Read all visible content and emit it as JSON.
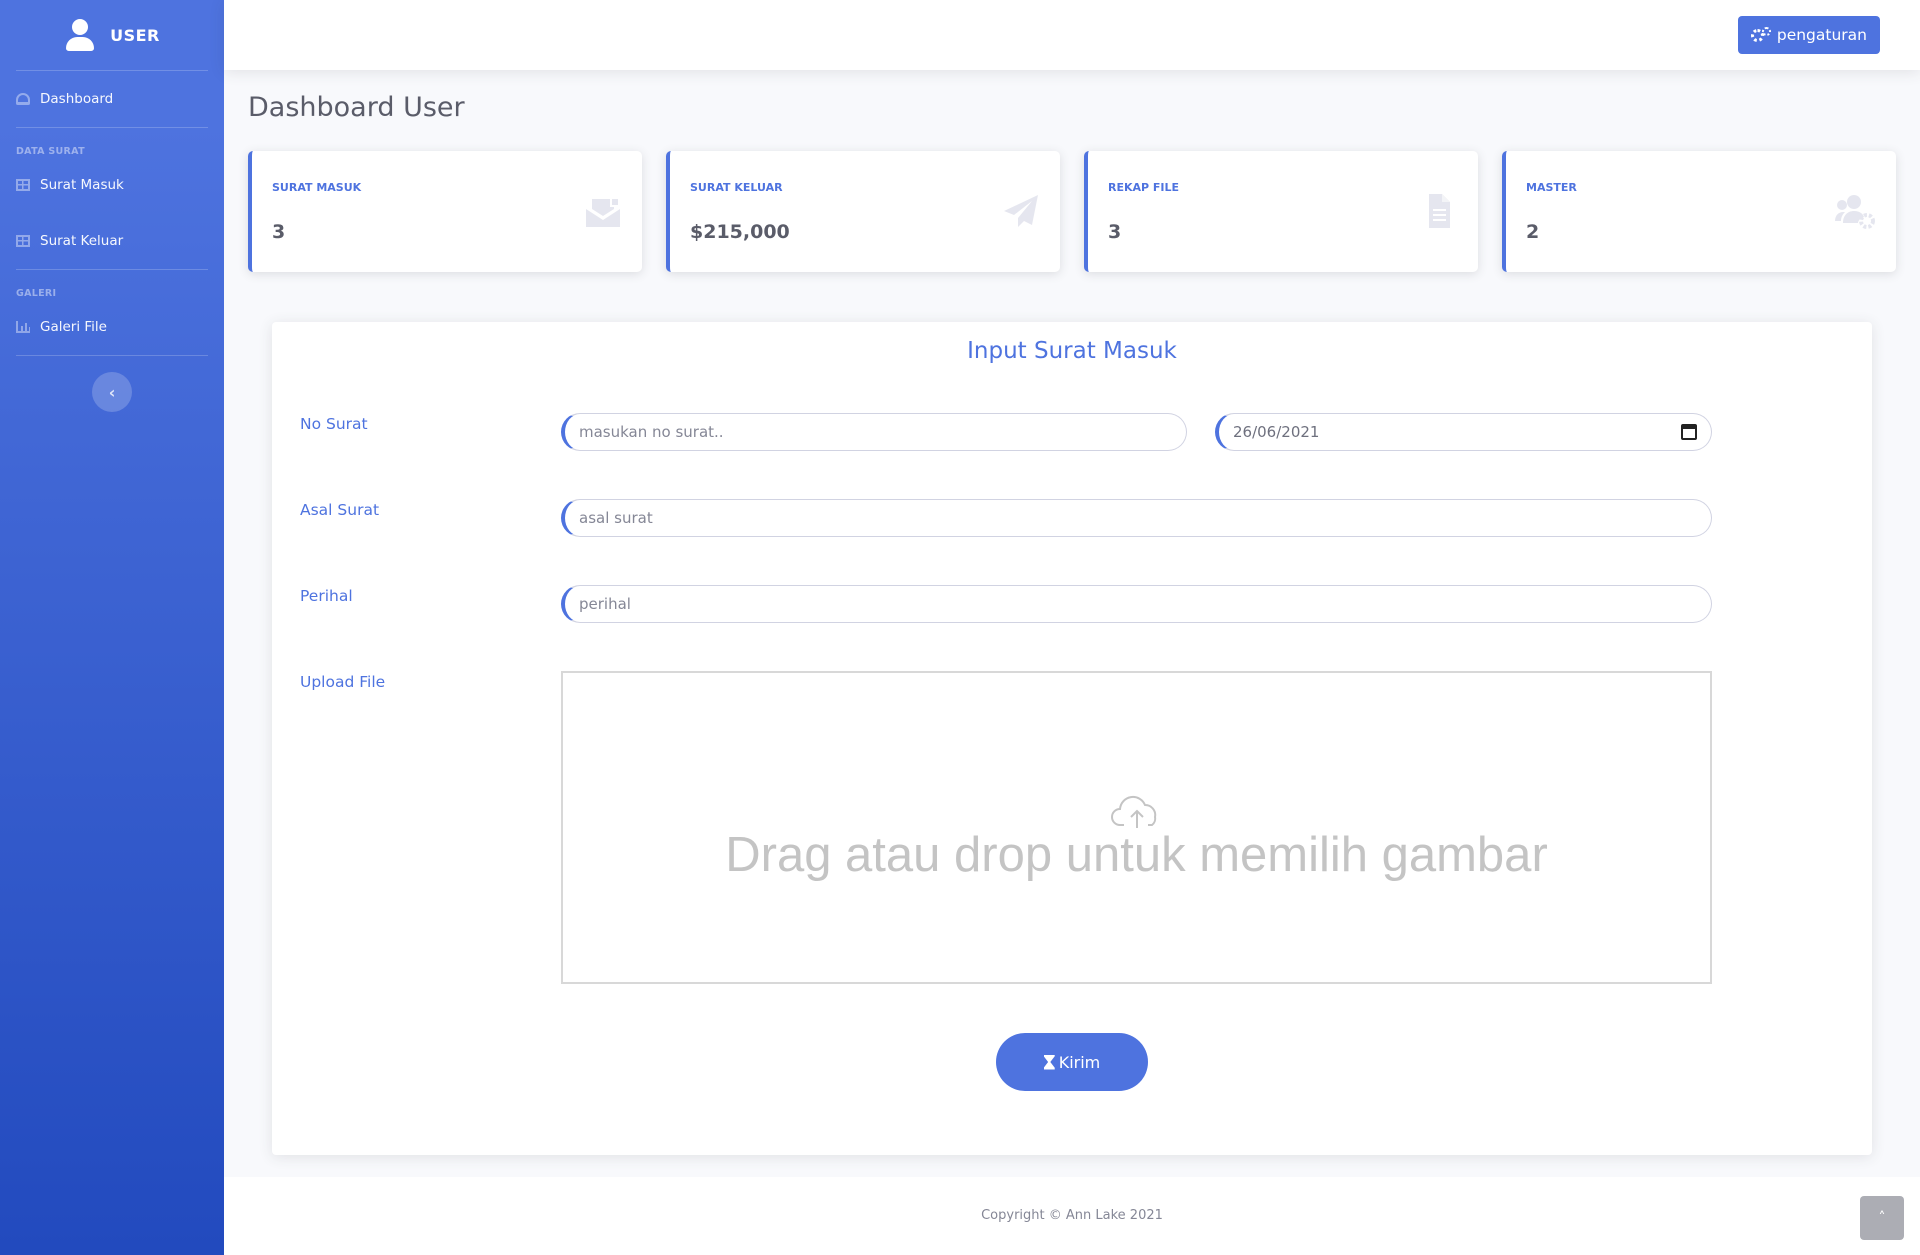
{
  "colors": {
    "primary": "#4e73df",
    "sidebar_gradient_start": "#4e73df",
    "sidebar_gradient_end": "#224abe"
  },
  "sidebar": {
    "brand": "USER",
    "brand_icon": "user-icon",
    "items": [
      {
        "label": "Dashboard",
        "icon": "tachometer-icon"
      },
      {
        "label": "Surat Masuk",
        "icon": "table-icon"
      },
      {
        "label": "Surat Keluar",
        "icon": "table-icon"
      },
      {
        "label": "Galeri File",
        "icon": "chart-area-icon"
      }
    ],
    "headings": [
      "DATA SURAT",
      "GALERI"
    ],
    "toggle_icon": "chevron-left-icon",
    "toggle_glyph": "‹"
  },
  "topbar": {
    "settings_label": "pengaturan",
    "settings_icon": "cogs-icon"
  },
  "page": {
    "title": "Dashboard User"
  },
  "cards": [
    {
      "label": "SURAT MASUK",
      "value": "3",
      "icon": "envelope-open-icon"
    },
    {
      "label": "SURAT KELUAR",
      "value": "$215,000",
      "icon": "paper-plane-icon"
    },
    {
      "label": "REKAP FILE",
      "value": "3",
      "icon": "file-alt-icon"
    },
    {
      "label": "MASTER",
      "value": "2",
      "icon": "users-cog-icon"
    }
  ],
  "form": {
    "title": "Input Surat Masuk",
    "labels": {
      "no_surat": "No Surat",
      "asal_surat": "Asal Surat",
      "perihal": "Perihal",
      "upload": "Upload File"
    },
    "no_surat_placeholder": "masukan no surat..",
    "date_value": "26/06/2021",
    "asal_surat_placeholder": "asal surat",
    "perihal_placeholder": "perihal",
    "dropzone_text": "Drag atau drop untuk memilih gambar",
    "dropzone_icon": "cloud-upload-icon",
    "submit_label": "Kirim",
    "submit_icon": "hourglass-icon"
  },
  "footer": {
    "copyright": "Copyright © Ann Lake 2021",
    "scroll_top_icon": "chevron-up-icon",
    "scroll_top_glyph": "˄"
  }
}
